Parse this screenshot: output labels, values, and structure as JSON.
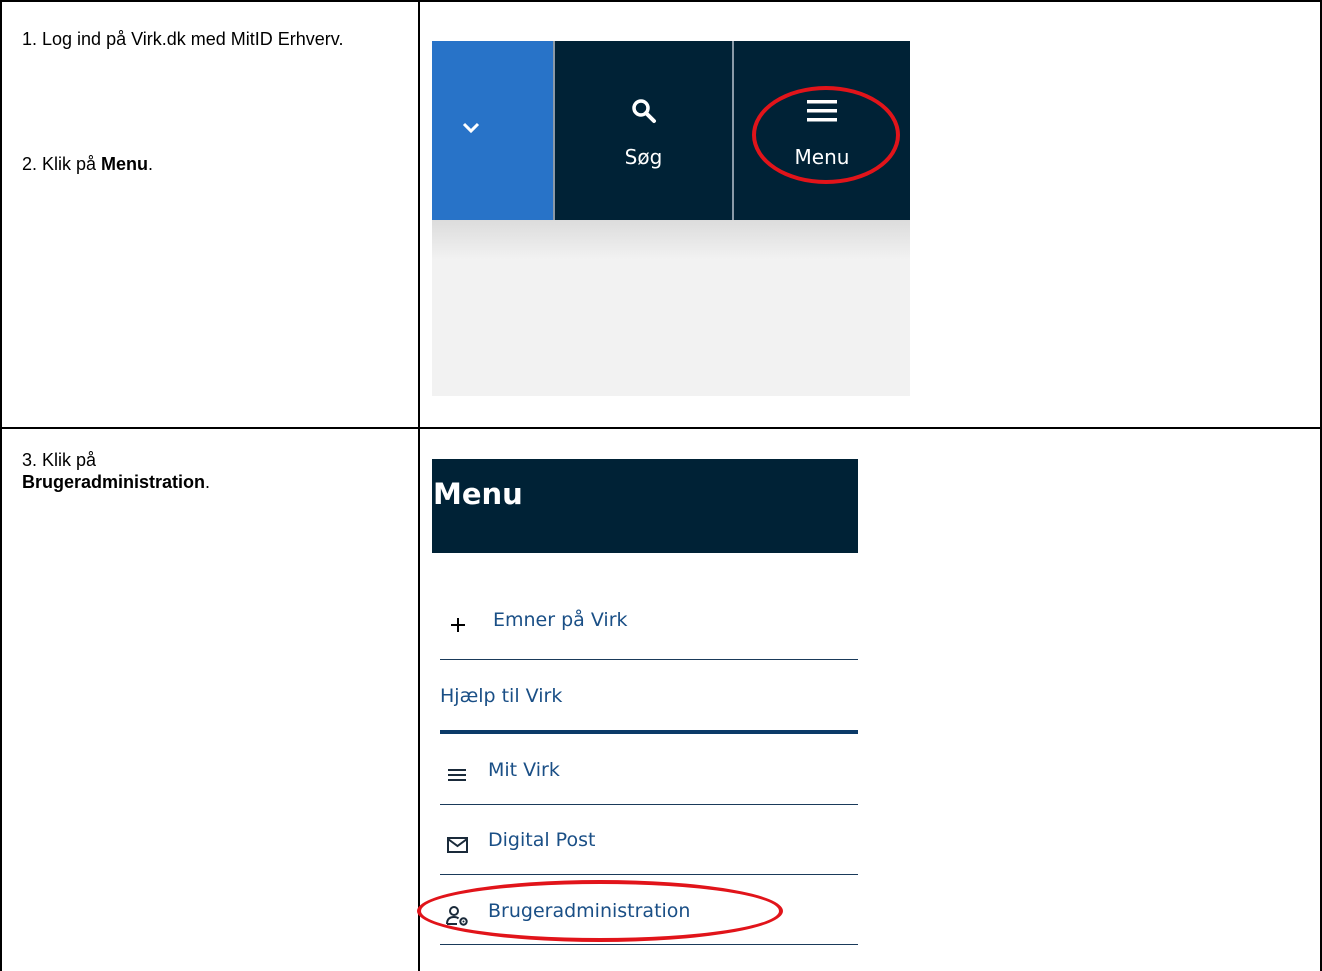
{
  "steps": {
    "step1": "1. Log ind på Virk.dk med MitID Erhverv.",
    "step2_prefix": "2. Klik på ",
    "step2_bold": "Menu",
    "step2_suffix": ".",
    "step3_prefix": "3. Klik på ",
    "step3_bold": "Brugeradministration",
    "step3_suffix": "."
  },
  "header_bar": {
    "search_label": "Søg",
    "menu_label": "Menu",
    "colors": {
      "bar": "#002236",
      "dropdown": "#2873c8",
      "highlight": "#e1141a"
    }
  },
  "menu": {
    "title": "Menu",
    "items": [
      {
        "label": "Emner på Virk",
        "icon": "plus-icon"
      },
      {
        "label": "Hjælp til Virk",
        "icon": ""
      },
      {
        "label": "Mit Virk",
        "icon": "hamburger-icon"
      },
      {
        "label": "Digital Post",
        "icon": "mail-icon"
      },
      {
        "label": "Brugeradministration",
        "icon": "user-settings-icon"
      }
    ]
  }
}
